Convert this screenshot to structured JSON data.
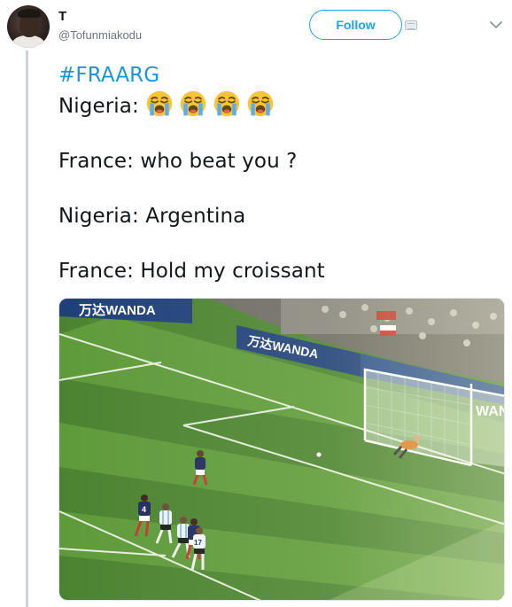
{
  "user": {
    "name": "T",
    "handle": "@Tofunmiakodu"
  },
  "follow_button": {
    "label": "Follow"
  },
  "tweet": {
    "hashtag": "#FRAARG",
    "line_nigeria_1": "Nigeria: ",
    "line_france_1": "France: who beat you ?",
    "line_nigeria_2": "Nigeria: Argentina",
    "line_france_2": "France: Hold my croissant",
    "emoji_count": 4,
    "emoji_name": "loudly-crying-face"
  },
  "media": {
    "ad_boards": [
      "万达WANDA",
      "万达WANDA",
      "WANDA"
    ],
    "player_numbers": [
      "4",
      "17"
    ]
  },
  "colors": {
    "link": "#1b95e0",
    "follow": "#1da1f2",
    "handle": "#657786",
    "pitch_light": "#5e9a3a",
    "pitch_dark": "#4b8330"
  }
}
